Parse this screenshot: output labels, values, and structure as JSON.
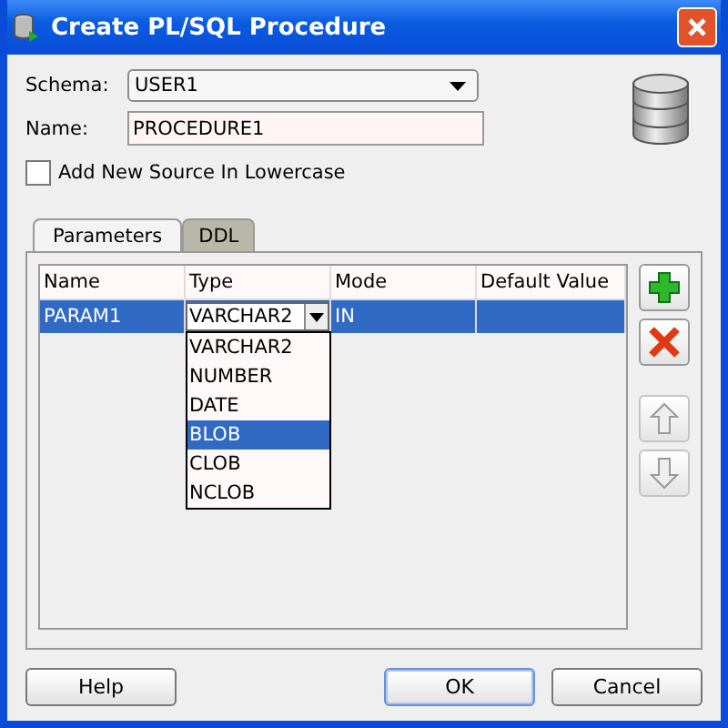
{
  "window": {
    "title": "Create PL/SQL Procedure"
  },
  "schema": {
    "label": "Schema:",
    "value": "USER1"
  },
  "name": {
    "label": "Name:",
    "value": "PROCEDURE1"
  },
  "lowercase_checkbox": {
    "label": "Add New Source In Lowercase",
    "checked": false
  },
  "tabs": [
    {
      "label": "Parameters",
      "selected": true
    },
    {
      "label": "DDL",
      "selected": false
    }
  ],
  "table": {
    "columns": [
      "Name",
      "Type",
      "Mode",
      "Default Value"
    ],
    "rows": [
      {
        "name": "PARAM1",
        "type": "VARCHAR2",
        "mode": "IN",
        "selected": true
      }
    ]
  },
  "type_dropdown": {
    "options": [
      {
        "label": "VARCHAR2",
        "selected": false
      },
      {
        "label": "NUMBER",
        "selected": false
      },
      {
        "label": "DATE",
        "selected": false
      },
      {
        "label": "BLOB",
        "selected": true
      },
      {
        "label": "CLOB",
        "selected": false
      },
      {
        "label": "NCLOB",
        "selected": false
      }
    ]
  },
  "side_buttons": [
    {
      "kind": "add",
      "disabled": false
    },
    {
      "kind": "delete",
      "disabled": false
    },
    {
      "kind": "up",
      "disabled": true
    },
    {
      "kind": "down",
      "disabled": true
    }
  ],
  "buttons": [
    {
      "label": "Help",
      "default": false
    },
    {
      "label": "OK",
      "default": true
    },
    {
      "label": "Cancel",
      "default": false
    }
  ]
}
